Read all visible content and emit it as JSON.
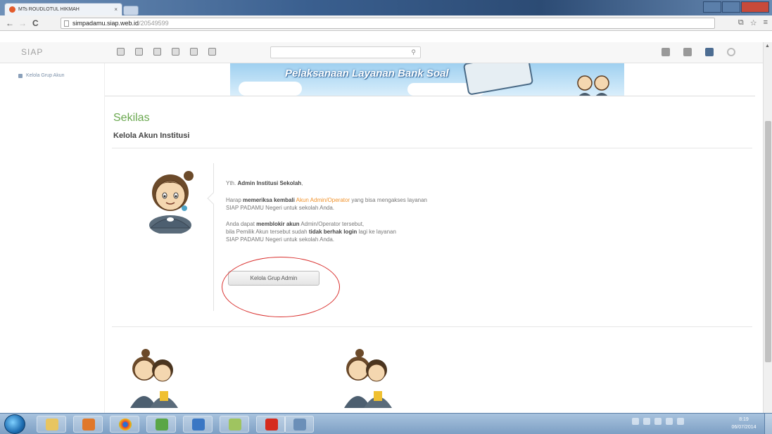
{
  "browser": {
    "tab_title": "MTs ROUDLOTUL HIKMAH",
    "tab_close": "×",
    "url_host": "simpadamu.siap.web.id",
    "url_path": "/20549599",
    "back": "←",
    "forward": "→",
    "reload": "C"
  },
  "app": {
    "logo": "SIAP",
    "search_icon": "magnifier-icon"
  },
  "sidebar": {
    "items": [
      {
        "label": "Kelola Grup Akun"
      }
    ]
  },
  "banner": {
    "text": "Pelaksanaan Layanan Bank Soal"
  },
  "main": {
    "title": "Sekilas",
    "subtitle": "Kelola Akun Institusi",
    "greeting_prefix": "Yth.",
    "greeting_name": "Admin Institusi Sekolah",
    "greeting_suffix": ",",
    "p1_a": "Harap",
    "p1_b": "memeriksa kembali",
    "p1_c": "Akun Admin/Operator",
    "p1_d": "yang bisa mengakses layanan",
    "p1_e": "SIAP PADAMU Negeri untuk sekolah Anda.",
    "p2_a": "Anda dapat",
    "p2_b": "memblokir akun",
    "p2_c": "Admin/Operator tersebut,",
    "p2_d": "bila Pemilik Akun tersebut sudah",
    "p2_e": "tidak berhak login",
    "p2_f": "lagi ke layanan",
    "p2_g": "SIAP PADAMU Negeri untuk sekolah Anda.",
    "button_label": "Kelola Grup Admin"
  },
  "taskbar": {
    "time": "8:19",
    "date": "06/07/2014"
  },
  "colors": {
    "heading_green": "#6aa84f",
    "highlight_orange": "#f0922b",
    "annotation_red": "#d9302e"
  }
}
